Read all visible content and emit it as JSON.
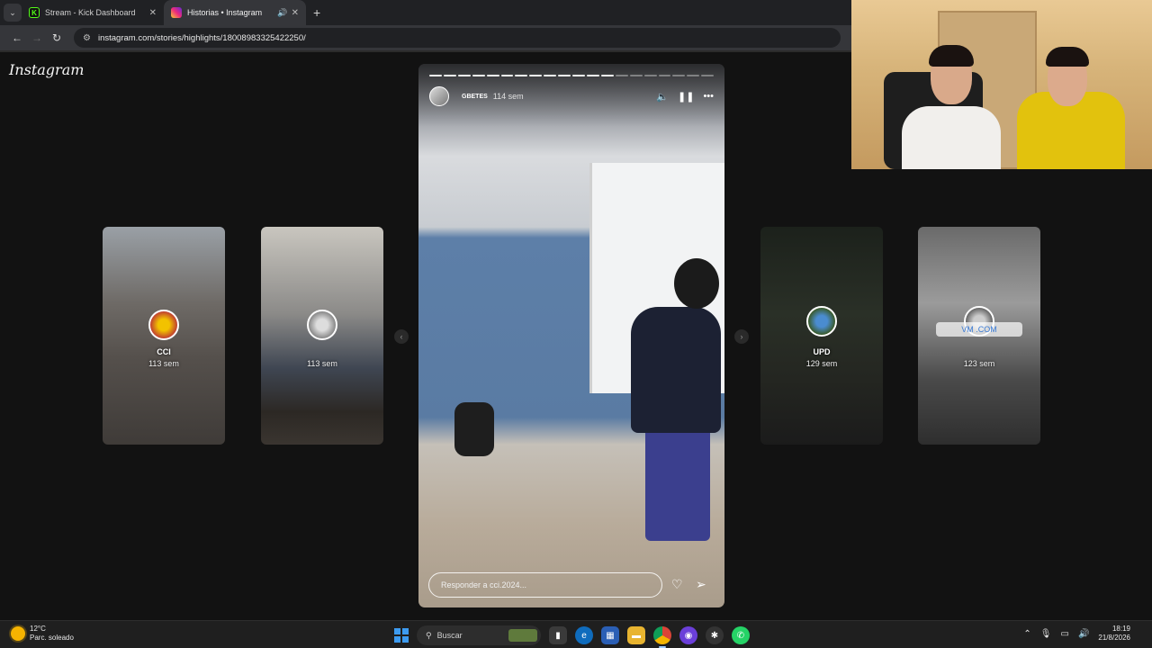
{
  "browser": {
    "tabs": [
      {
        "title": "Stream - Kick Dashboard",
        "active": false
      },
      {
        "title": "Historias • Instagram",
        "active": true
      }
    ],
    "url": "instagram.com/stories/highlights/18008983325422250/"
  },
  "instagram": {
    "logo": "Instagram",
    "story": {
      "username": "GBETES",
      "time": "114 sem",
      "reply_placeholder": "Responder a cci.2024...",
      "progress_total": 20,
      "progress_done": 13
    },
    "highlights": [
      {
        "label": "CCI",
        "time": "113 sem"
      },
      {
        "label": "",
        "time": "113 sem"
      },
      {
        "label": "UPD",
        "time": "129 sem"
      },
      {
        "label": "",
        "time": "123 sem",
        "sticker": "VM                .COM"
      }
    ]
  },
  "taskbar": {
    "weather": {
      "temp": "12°C",
      "desc": "Parc. soleado"
    },
    "search_placeholder": "Buscar",
    "clock": {
      "time": "18:19",
      "date": "21/8/2026"
    }
  },
  "colors": {
    "instagram_bg": "#121212",
    "accent_blue": "#3d9bf0",
    "kick_green": "#53fc18"
  }
}
